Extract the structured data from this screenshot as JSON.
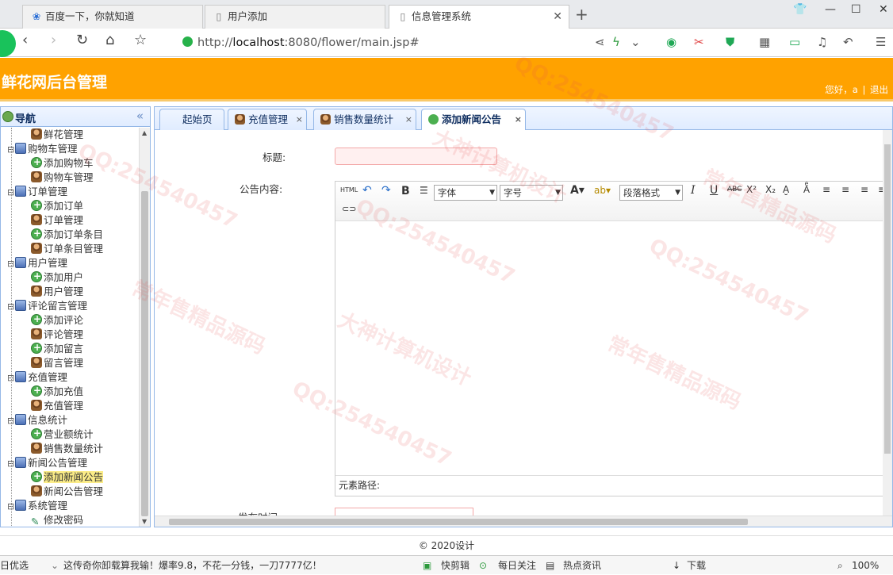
{
  "browser": {
    "tabs": [
      {
        "label": "百度一下，你就知道"
      },
      {
        "label": "用户添加"
      },
      {
        "label": "信息管理系统"
      }
    ],
    "new_tab": "+",
    "url_prefix": "http://",
    "url_host": "localhost",
    "url_rest": ":8080/flower/main.jsp#"
  },
  "app": {
    "title": "鲜花网后台管理",
    "greeting": "您好，a",
    "separator": "|",
    "logout": "退出"
  },
  "sidebar": {
    "title": "导航",
    "collapse": "«",
    "nodes": [
      {
        "label": "鲜花管理",
        "type": "user",
        "level": 2
      },
      {
        "label": "购物车管理",
        "type": "folder",
        "level": 1
      },
      {
        "label": "添加购物车",
        "type": "add",
        "level": 2
      },
      {
        "label": "购物车管理",
        "type": "user",
        "level": 2
      },
      {
        "label": "订单管理",
        "type": "folder",
        "level": 1
      },
      {
        "label": "添加订单",
        "type": "add",
        "level": 2
      },
      {
        "label": "订单管理",
        "type": "user",
        "level": 2
      },
      {
        "label": "添加订单条目",
        "type": "add",
        "level": 2
      },
      {
        "label": "订单条目管理",
        "type": "user",
        "level": 2
      },
      {
        "label": "用户管理",
        "type": "folder",
        "level": 1
      },
      {
        "label": "添加用户",
        "type": "add",
        "level": 2
      },
      {
        "label": "用户管理",
        "type": "user",
        "level": 2
      },
      {
        "label": "评论留言管理",
        "type": "folder",
        "level": 1
      },
      {
        "label": "添加评论",
        "type": "add",
        "level": 2
      },
      {
        "label": "评论管理",
        "type": "user",
        "level": 2
      },
      {
        "label": "添加留言",
        "type": "add",
        "level": 2
      },
      {
        "label": "留言管理",
        "type": "user",
        "level": 2
      },
      {
        "label": "充值管理",
        "type": "folder",
        "level": 1
      },
      {
        "label": "添加充值",
        "type": "add",
        "level": 2
      },
      {
        "label": "充值管理",
        "type": "user",
        "level": 2
      },
      {
        "label": "信息统计",
        "type": "folder",
        "level": 1
      },
      {
        "label": "营业额统计",
        "type": "add",
        "level": 2
      },
      {
        "label": "销售数量统计",
        "type": "user",
        "level": 2
      },
      {
        "label": "新闻公告管理",
        "type": "folder",
        "level": 1
      },
      {
        "label": "添加新闻公告",
        "type": "add",
        "level": 2,
        "selected": true
      },
      {
        "label": "新闻公告管理",
        "type": "user",
        "level": 2
      },
      {
        "label": "系统管理",
        "type": "folder",
        "level": 1
      },
      {
        "label": "修改密码",
        "type": "edit",
        "level": 2
      }
    ]
  },
  "main_tabs": [
    {
      "label": "起始页",
      "closable": false,
      "icon": "none"
    },
    {
      "label": "充值管理",
      "closable": true,
      "icon": "user"
    },
    {
      "label": "销售数量统计",
      "closable": true,
      "icon": "user"
    },
    {
      "label": "添加新闻公告",
      "closable": true,
      "icon": "add",
      "active": true
    }
  ],
  "tab_close": "×",
  "form": {
    "title_label": "标题:",
    "content_label": "公告内容:",
    "time_label": "发布时间:",
    "font_select": "字体",
    "size_select": "字号",
    "paragraph_select": "段落格式",
    "element_path": "元素路径:"
  },
  "footer": "© 2020设计",
  "statusbar": {
    "left": "日优选",
    "ad": "这传奇你卸载算我输！爆率9.8，不花一分钱，一刀7777亿！",
    "items": [
      "快剪辑",
      "每日关注",
      "热点资讯",
      "下载"
    ],
    "zoom": "100%"
  },
  "watermarks": {
    "qq": "QQ:254540457",
    "a": "常年售精品源码",
    "b": "大神计算机设计"
  }
}
